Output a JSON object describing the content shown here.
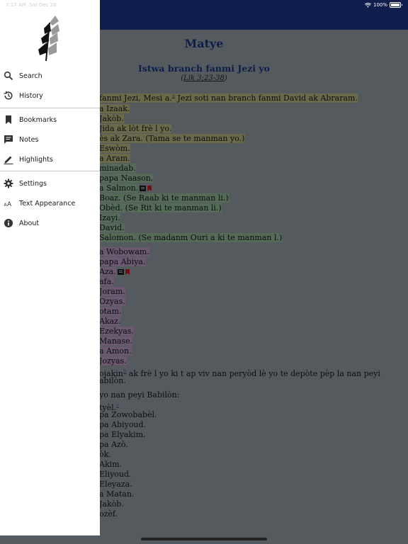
{
  "status": {
    "time": "7:17 AM",
    "date": "Sat Dec 28",
    "battery": "100%"
  },
  "reader": {
    "book_title": "Matye",
    "section_title": "Istwa branch fanmi Jezi yo",
    "section_ref": "Lik 3;23-38",
    "lines": [
      {
        "pre": "fanmi Jezi, Mesi a.",
        "fn": "a",
        "post": " Jezi soti nan branch fanmi David ak Abraram.",
        "hl": "y"
      },
      {
        "pre": "a Izaak.",
        "hl": "y"
      },
      {
        "pre": "Jakòb.",
        "hl": "y"
      },
      {
        "pre": "Jida ak lòt frè l yo.",
        "hl": "y"
      },
      {
        "pre": "ès ak Zara. (Tama se te manman yo.)",
        "hl": "y"
      },
      {
        "pre": "Eswòm.",
        "hl": "y"
      },
      {
        "pre": "a Aram.",
        "hl": "y"
      },
      {
        "pre": "minadab.",
        "hl": "g"
      },
      {
        "pre": "papa Naason,",
        "hl": "g"
      },
      {
        "pre": "a Salmon.",
        "hl": "g",
        "note": true,
        "bm": true
      },
      {
        "pre": "Boaz. (Se Raab ki te manman li.)",
        "hl": "g"
      },
      {
        "pre": "Obèd. (Se Rit ki te manman li.)",
        "hl": "g"
      },
      {
        "pre": "Izayi.",
        "hl": "g"
      },
      {
        "pre": " David.",
        "hl": "g"
      },
      {
        "pre": " Salomon. (Se madanm Ouri a ki te manman l.)",
        "hl": "g"
      },
      {
        "pre": "a Wobowam.",
        "hl": "p"
      },
      {
        "pre": "papa Abiya.",
        "hl": "p"
      },
      {
        "pre": "Aza.",
        "hl": "p",
        "note": true,
        "bm": true
      },
      {
        "pre": "afa.",
        "hl": "p"
      },
      {
        "pre": " Joram.",
        "hl": "p"
      },
      {
        "pre": " Ozyas.",
        "hl": "p"
      },
      {
        "pre": "otam.",
        "hl": "p"
      },
      {
        "pre": " Akaz.",
        "hl": "p"
      },
      {
        "pre": "Ezekyas.",
        "hl": "p"
      },
      {
        "pre": " Manase.",
        "hl": "p"
      },
      {
        "pre": "a Amon.",
        "hl": "p"
      },
      {
        "pre": " Jozyas.",
        "hl": "p"
      },
      {
        "pre": "ojakin",
        "fn": "b",
        "post": " ak frè l yo ki t ap viv nan peryòd lè yo te depòte pèp la nan peyi",
        "hl": ""
      },
      {
        "pre": "abilòn.",
        "hl": ""
      },
      {
        "pre": "yo nan peyi Babilòn:",
        "hl": ""
      },
      {
        "pre": "tyèl.",
        "fn": "c",
        "hl": ""
      },
      {
        "pre": "pa Zowobabèl.",
        "hl": ""
      },
      {
        "pre": "pa Abiyoud.",
        "hl": ""
      },
      {
        "pre": "pa Elyakim.",
        "hl": ""
      },
      {
        "pre": "pa Azò.",
        "hl": ""
      },
      {
        "pre": "òk.",
        "hl": ""
      },
      {
        "pre": " Akim.",
        "hl": ""
      },
      {
        "pre": "Eliyoud.",
        "hl": ""
      },
      {
        "pre": " Eleyaza.",
        "hl": ""
      },
      {
        "pre": "a Matan.",
        "hl": ""
      },
      {
        "pre": " Jakòb.",
        "hl": ""
      },
      {
        "pre": "ozèf.",
        "hl": ""
      }
    ]
  },
  "drawer": {
    "logo_icon": "wheat-icon",
    "items": [
      {
        "id": "search",
        "label": "Search",
        "icon": "search-icon"
      },
      {
        "id": "history",
        "label": "History",
        "icon": "history-icon"
      },
      {
        "id": "bookmarks",
        "label": "Bookmarks",
        "icon": "bookmark-icon"
      },
      {
        "id": "notes",
        "label": "Notes",
        "icon": "note-icon"
      },
      {
        "id": "highlights",
        "label": "Highlights",
        "icon": "highlighter-icon"
      },
      {
        "id": "settings",
        "label": "Settings",
        "icon": "gear-icon"
      },
      {
        "id": "text-appearance",
        "label": "Text Appearance",
        "icon": "text-size-icon"
      },
      {
        "id": "about",
        "label": "About",
        "icon": "info-icon"
      }
    ]
  },
  "colors": {
    "header": "#0f1e4d",
    "title": "#0e1e4a",
    "drawer_bg": "#ffffff",
    "overlay": "#5f5f5f"
  }
}
